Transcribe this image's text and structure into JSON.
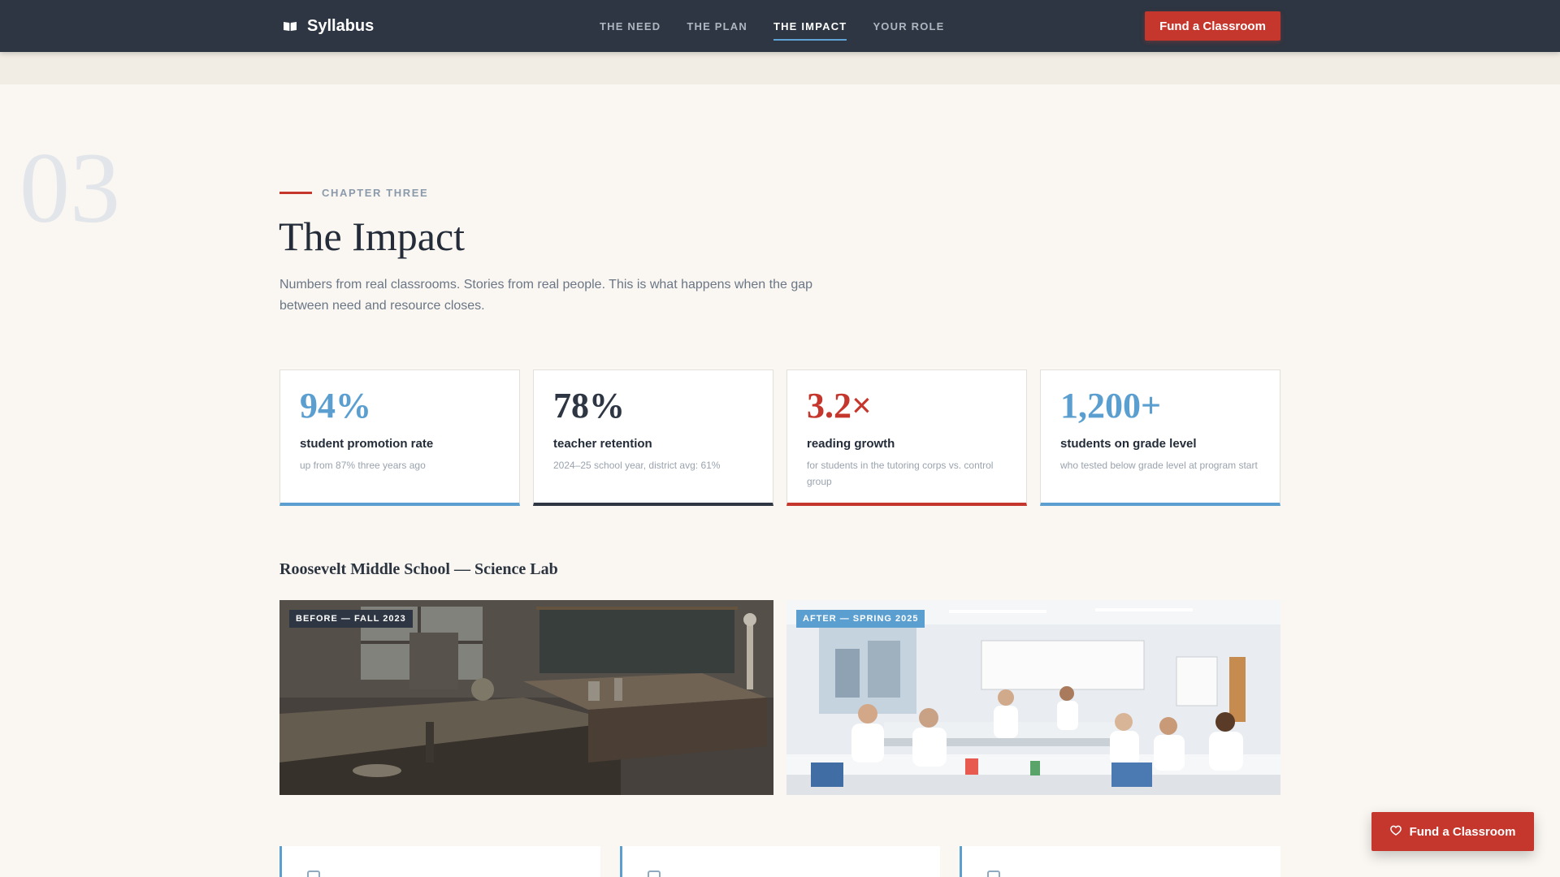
{
  "brand": {
    "name": "Syllabus",
    "icon": "book-icon"
  },
  "nav": {
    "links": [
      {
        "label": "THE NEED",
        "active": false
      },
      {
        "label": "THE PLAN",
        "active": false
      },
      {
        "label": "THE IMPACT",
        "active": true
      },
      {
        "label": "YOUR ROLE",
        "active": false
      }
    ],
    "cta_label": "Fund a Classroom"
  },
  "chapter": {
    "number": "03",
    "eyebrow": "CHAPTER THREE",
    "title": "The Impact",
    "lede": "Numbers from real classrooms. Stories from real people. This is what happens when the gap between need and resource closes."
  },
  "stats": [
    {
      "value": "94%",
      "label": "student promotion rate",
      "sub": "up from 87% three years ago",
      "accent": "#5b9fd0"
    },
    {
      "value": "78%",
      "label": "teacher retention",
      "sub": "2024–25 school year, district avg: 61%",
      "accent": "#2d3642"
    },
    {
      "value": "3.2×",
      "label": "reading growth",
      "sub": "for students in the tutoring corps vs. control group",
      "accent": "#c5372d"
    },
    {
      "value": "1,200+",
      "label": "students on grade level",
      "sub": "who tested below grade level at program start",
      "accent": "#5b9fd0"
    }
  ],
  "gallery": {
    "title": "Roosevelt Middle School — Science Lab",
    "before_tag": "BEFORE — FALL 2023",
    "after_tag": "AFTER — SPRING 2025"
  },
  "float_cta": {
    "label": "Fund a Classroom",
    "icon": "heart-icon"
  },
  "colors": {
    "nav_bg": "#2d3642",
    "brand_red": "#c5372d",
    "accent_blue": "#5b9fd0",
    "page_bg": "#faf7f2"
  }
}
